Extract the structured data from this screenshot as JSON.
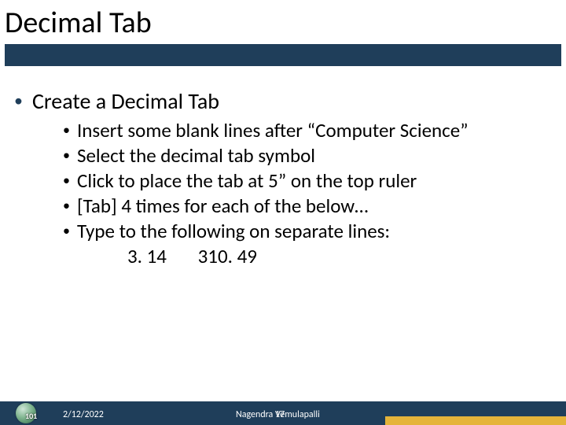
{
  "title": "Decimal Tab",
  "content": {
    "heading": "Create a Decimal Tab",
    "sub_items": [
      "Insert some blank lines after “Computer Science”",
      "Select the decimal tab symbol",
      "Click to place the tab at 5” on the top ruler",
      "[Tab] 4 times for each of the below…",
      "Type to the following on separate lines:"
    ],
    "numbers": {
      "a": "3. 14",
      "b": "310. 49"
    }
  },
  "footer": {
    "date": "2/12/2022",
    "author": "Nagendra Vemulapalli",
    "page": "17",
    "logo_text": "101"
  }
}
